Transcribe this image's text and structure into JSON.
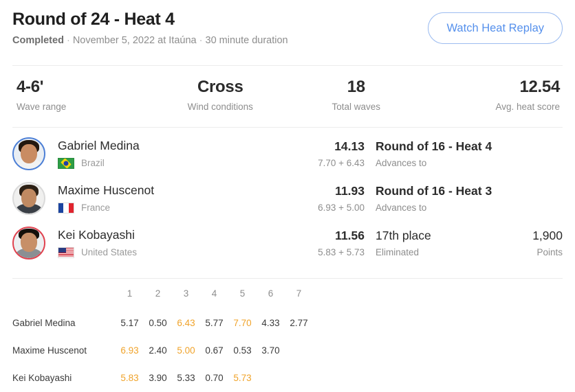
{
  "header": {
    "title": "Round of 24 - Heat 4",
    "status": "Completed",
    "sep": "·",
    "date_location": "November 5, 2022 at Itaúna",
    "duration": "30 minute duration",
    "replay_button": "Watch Heat Replay"
  },
  "stats": [
    {
      "value": "4-6'",
      "label": "Wave range"
    },
    {
      "value": "Cross",
      "label": "Wind conditions"
    },
    {
      "value": "18",
      "label": "Total waves"
    },
    {
      "value": "12.54",
      "label": "Avg. heat score"
    }
  ],
  "surfers": [
    {
      "name": "Gabriel Medina",
      "country": "Brazil",
      "flag": "brazil-flag",
      "ring": "blue",
      "score": "14.13",
      "score_detail": "7.70 + 6.43",
      "outcome": "Round of 16 - Heat 4",
      "outcome_label": "Advances to",
      "points": "",
      "points_label": ""
    },
    {
      "name": "Maxime Huscenot",
      "country": "France",
      "flag": "france-flag",
      "ring": "gray",
      "score": "11.93",
      "score_detail": "6.93 + 5.00",
      "outcome": "Round of 16 - Heat 3",
      "outcome_label": "Advances to",
      "points": "",
      "points_label": ""
    },
    {
      "name": "Kei Kobayashi",
      "country": "United States",
      "flag": "usa-flag",
      "ring": "red",
      "score": "11.56",
      "score_detail": "5.83 + 5.73",
      "outcome": "17th place",
      "outcome_label": "Eliminated",
      "points": "1,900",
      "points_label": "Points"
    }
  ],
  "wave_table": {
    "columns": [
      "1",
      "2",
      "3",
      "4",
      "5",
      "6",
      "7"
    ],
    "rows": [
      {
        "name": "Gabriel Medina",
        "scores": [
          "5.17",
          "0.50",
          "6.43",
          "5.77",
          "7.70",
          "4.33",
          "2.77"
        ],
        "counting": [
          false,
          false,
          true,
          false,
          true,
          false,
          false
        ]
      },
      {
        "name": "Maxime Huscenot",
        "scores": [
          "6.93",
          "2.40",
          "5.00",
          "0.67",
          "0.53",
          "3.70",
          ""
        ],
        "counting": [
          true,
          false,
          true,
          false,
          false,
          false,
          false
        ]
      },
      {
        "name": "Kei Kobayashi",
        "scores": [
          "5.83",
          "3.90",
          "5.33",
          "0.70",
          "5.73",
          "",
          ""
        ],
        "counting": [
          true,
          false,
          false,
          false,
          true,
          false,
          false
        ]
      }
    ]
  },
  "colors": {
    "accent_blue": "#5590ec",
    "counting_orange": "#f0a32a",
    "eliminated_red": "#e0424f",
    "advance_blue": "#4c7fd6"
  }
}
